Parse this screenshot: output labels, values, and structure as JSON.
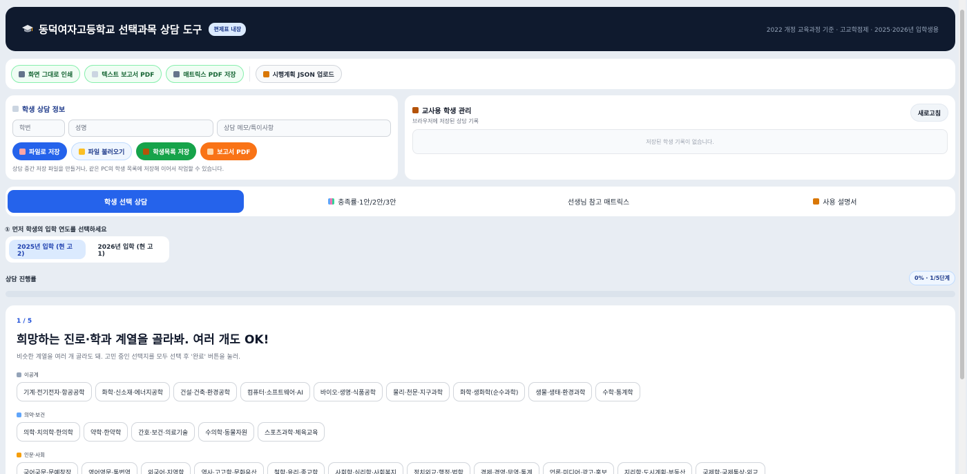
{
  "header": {
    "title": "동덕여자고등학교 선택과목 상담 도구",
    "badge": "편제표 내장",
    "subtitle": "2022 개정 교육과정 기준 · 고교학점제 · 2025·2026년 입학생용"
  },
  "toolbar": {
    "print_screen": "화면 그대로 인쇄",
    "text_report_pdf": "텍스트 보고서 PDF",
    "matrix_pdf": "매트릭스 PDF 저장",
    "plan_upload": "시행계획 JSON 업로드"
  },
  "student_info": {
    "title": "학생 상담 정보",
    "id_placeholder": "학번",
    "name_placeholder": "성명",
    "memo_placeholder": "상담 메모/특이사항",
    "save_file": "파일로 저장",
    "load_file": "파일 불러오기",
    "save_list": "학생목록 저장",
    "report_pdf": "보고서 PDF",
    "hint": "상담 중간 저장 파일을 만들거나, 같은 PC의 학생 목록에 저장해 이어서 작업할 수 있습니다."
  },
  "teacher_panel": {
    "title": "교사용 학생 관리",
    "subtitle": "브라우저에 저장된 상담 기록",
    "refresh": "새로고침",
    "empty": "저장된 학생 기록이 없습니다."
  },
  "tabs": [
    {
      "label": "학생 선택 상담",
      "icon": ""
    },
    {
      "label": "충족률·1안/2안/3안",
      "icon": "bar-chart-icon"
    },
    {
      "label": "선생님 참고 매트릭스",
      "icon": ""
    },
    {
      "label": "사용 설명서",
      "icon": "clipboard-icon"
    }
  ],
  "year": {
    "question": "① 먼저 학생의 입학 연도를 선택하세요",
    "options": [
      "2025년 입학 (현 고2)",
      "2026년 입학 (현 고1)"
    ],
    "selected": "2025년 입학 (현 고2)"
  },
  "progress": {
    "label": "상담 진행률",
    "badge": "0% · 1/5단계",
    "percent": 0
  },
  "question": {
    "step": "1 / 5",
    "title": "희망하는 진로·학과 계열을 골라봐. 여러 개도 OK!",
    "subtitle": "비슷한 계열을 여러 개 골라도 돼. 고민 중인 선택지를 모두 선택 후 '완료' 버튼을 눌러.",
    "categories": [
      {
        "label": "이공계",
        "icon": "flask-icon",
        "items": [
          "기계·전기전자·항공공학",
          "화학·신소재·에너지공학",
          "건설·건축·환경공학",
          "컴퓨터·소프트웨어·AI",
          "바이오·생명·식품공학",
          "물리·천문·지구과학",
          "화학·생화학(순수과학)",
          "생물·생태·환경과학",
          "수학·통계학"
        ]
      },
      {
        "label": "의약·보건",
        "icon": "stethoscope-icon",
        "items": [
          "의학·치의학·한의학",
          "약학·한약학",
          "간호·보건·의료기술",
          "수의학·동물자원",
          "스포츠과학·체육교육"
        ]
      },
      {
        "label": "인문·사회",
        "icon": "books-icon",
        "items": [
          "국어국문·문예창작",
          "영어영문·통번역",
          "외국어·지역학",
          "역사·고고학·문화유산",
          "철학·윤리·종교학",
          "사회학·심리학·사회복지",
          "정치외교·행정·법학",
          "경제·경영·무역·통계",
          "언론·미디어·광고·홍보",
          "지리학·도시계획·부동산",
          "국제학·국제통상·외교"
        ]
      }
    ]
  },
  "colors": {
    "header_bg": "#0f1a2e",
    "primary": "#2563eb",
    "green": "#16a34a",
    "orange": "#f97316"
  }
}
